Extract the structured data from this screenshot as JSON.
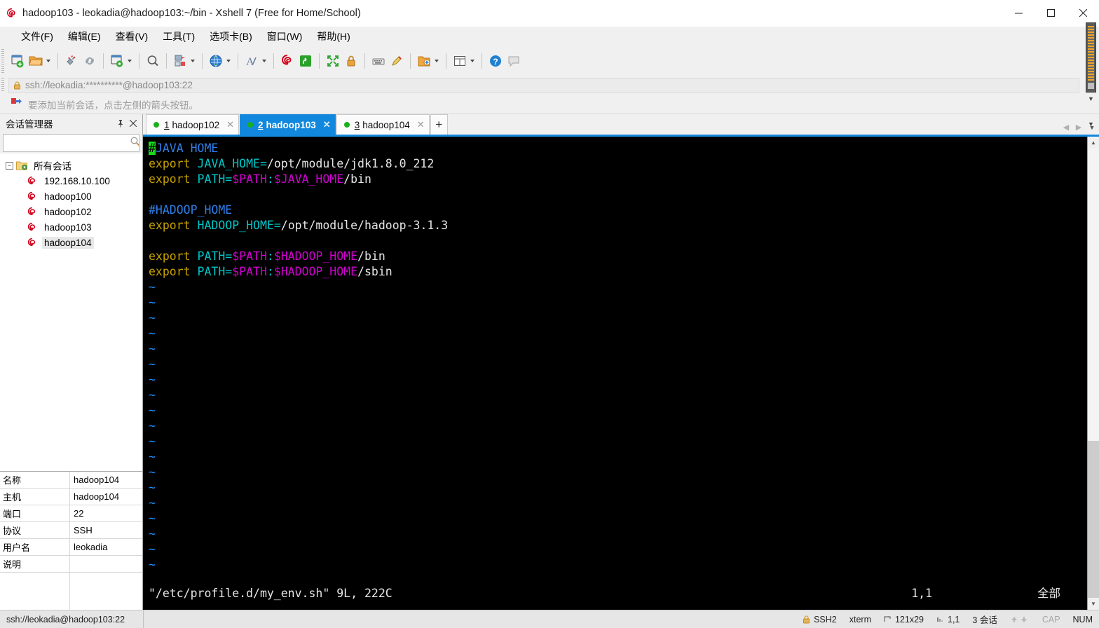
{
  "window": {
    "title": "hadoop103 - leokadia@hadoop103:~/bin - Xshell 7 (Free for Home/School)",
    "app_icon": "xshell-logo-icon",
    "minimize_label": "—",
    "maximize_label": "□",
    "close_label": "✕"
  },
  "menu": {
    "items": [
      {
        "label": "文件(F)",
        "name": "menu-file"
      },
      {
        "label": "编辑(E)",
        "name": "menu-edit"
      },
      {
        "label": "查看(V)",
        "name": "menu-view"
      },
      {
        "label": "工具(T)",
        "name": "menu-tools"
      },
      {
        "label": "选项卡(B)",
        "name": "menu-tabs"
      },
      {
        "label": "窗口(W)",
        "name": "menu-window"
      },
      {
        "label": "帮助(H)",
        "name": "menu-help"
      }
    ]
  },
  "toolbar": {
    "buttons": [
      "new-session-icon",
      "open-folder-icon",
      "disconnect-icon",
      "reconnect-icon",
      "session-properties-icon",
      "find-icon",
      "transfer-file-icon",
      "globe-icon",
      "font-icon",
      "xshell-icon",
      "xftp-icon",
      "fullscreen-icon",
      "lock-icon",
      "keyboard-icon",
      "highlight-icon",
      "new-folder-icon",
      "layout-icon",
      "help-icon",
      "comment-icon"
    ]
  },
  "address": {
    "value": "ssh://leokadia:**********@hadoop103:22",
    "lock_icon": "lock-icon",
    "overflow_label": "»"
  },
  "notify": {
    "icon": "flag-arrow-icon",
    "text": "要添加当前会话，点击左侧的箭头按钮。"
  },
  "sidebar": {
    "title": "会话管理器",
    "pin_label": "⚐",
    "close_label": "✕",
    "search": {
      "value": "",
      "placeholder": ""
    },
    "search_icon": "search-icon",
    "root": {
      "label": "所有会话",
      "icon": "folder-sessions-icon",
      "expander": "−"
    },
    "sessions": [
      {
        "label": "192.168.10.100",
        "icon": "session-icon",
        "selected": false
      },
      {
        "label": "hadoop100",
        "icon": "session-icon",
        "selected": false
      },
      {
        "label": "hadoop102",
        "icon": "session-icon",
        "selected": false
      },
      {
        "label": "hadoop103",
        "icon": "session-icon",
        "selected": false
      },
      {
        "label": "hadoop104",
        "icon": "session-icon",
        "selected": true
      }
    ],
    "properties": [
      {
        "key": "名称",
        "value": "hadoop104"
      },
      {
        "key": "主机",
        "value": "hadoop104"
      },
      {
        "key": "端口",
        "value": "22"
      },
      {
        "key": "协议",
        "value": "SSH"
      },
      {
        "key": "用户名",
        "value": "leokadia"
      },
      {
        "key": "说明",
        "value": ""
      }
    ]
  },
  "tabs": {
    "items": [
      {
        "num": "1",
        "label": "hadoop102",
        "active": false,
        "close": "✕"
      },
      {
        "num": "2",
        "label": "hadoop103",
        "active": true,
        "close": "✕"
      },
      {
        "num": "3",
        "label": "hadoop104",
        "active": false,
        "close": "✕"
      }
    ],
    "add_label": "+",
    "nav_prev": "◀",
    "nav_next": "▶",
    "nav_list": "▼"
  },
  "terminal": {
    "lines": [
      {
        "segments": [
          {
            "t": "#",
            "c": "cursor"
          },
          {
            "t": "JAVA HOME",
            "c": "c-blue"
          }
        ]
      },
      {
        "segments": [
          {
            "t": "export ",
            "c": "c-yellow"
          },
          {
            "t": "JAVA_HOME=",
            "c": "c-cyan"
          },
          {
            "t": "/opt/module/jdk1.8.0_212",
            "c": "c-white"
          }
        ]
      },
      {
        "segments": [
          {
            "t": "export ",
            "c": "c-yellow"
          },
          {
            "t": "PATH=",
            "c": "c-cyan"
          },
          {
            "t": "$PATH",
            "c": "c-mag"
          },
          {
            "t": ":",
            "c": "c-cyan"
          },
          {
            "t": "$JAVA_HOME",
            "c": "c-mag"
          },
          {
            "t": "/bin",
            "c": "c-white"
          }
        ]
      },
      {
        "segments": []
      },
      {
        "segments": [
          {
            "t": "#HADOOP_HOME",
            "c": "c-blue"
          }
        ]
      },
      {
        "segments": [
          {
            "t": "export ",
            "c": "c-yellow"
          },
          {
            "t": "HADOOP_HOME=",
            "c": "c-cyan"
          },
          {
            "t": "/opt/module/hadoop-3.1.3",
            "c": "c-white"
          }
        ]
      },
      {
        "segments": []
      },
      {
        "segments": [
          {
            "t": "export ",
            "c": "c-yellow"
          },
          {
            "t": "PATH=",
            "c": "c-cyan"
          },
          {
            "t": "$PATH",
            "c": "c-mag"
          },
          {
            "t": ":",
            "c": "c-cyan"
          },
          {
            "t": "$HADOOP_HOME",
            "c": "c-mag"
          },
          {
            "t": "/bin",
            "c": "c-white"
          }
        ]
      },
      {
        "segments": [
          {
            "t": "export ",
            "c": "c-yellow"
          },
          {
            "t": "PATH=",
            "c": "c-cyan"
          },
          {
            "t": "$PATH",
            "c": "c-mag"
          },
          {
            "t": ":",
            "c": "c-cyan"
          },
          {
            "t": "$HADOOP_HOME",
            "c": "c-mag"
          },
          {
            "t": "/sbin",
            "c": "c-white"
          }
        ]
      },
      {
        "segments": [
          {
            "t": "~",
            "c": "c-blue2"
          }
        ]
      },
      {
        "segments": [
          {
            "t": "~",
            "c": "c-blue2"
          }
        ]
      },
      {
        "segments": [
          {
            "t": "~",
            "c": "c-blue2"
          }
        ]
      },
      {
        "segments": [
          {
            "t": "~",
            "c": "c-blue2"
          }
        ]
      },
      {
        "segments": [
          {
            "t": "~",
            "c": "c-blue2"
          }
        ]
      },
      {
        "segments": [
          {
            "t": "~",
            "c": "c-blue2"
          }
        ]
      },
      {
        "segments": [
          {
            "t": "~",
            "c": "c-blue2"
          }
        ]
      },
      {
        "segments": [
          {
            "t": "~",
            "c": "c-blue2"
          }
        ]
      },
      {
        "segments": [
          {
            "t": "~",
            "c": "c-blue2"
          }
        ]
      },
      {
        "segments": [
          {
            "t": "~",
            "c": "c-blue2"
          }
        ]
      },
      {
        "segments": [
          {
            "t": "~",
            "c": "c-blue2"
          }
        ]
      },
      {
        "segments": [
          {
            "t": "~",
            "c": "c-blue2"
          }
        ]
      },
      {
        "segments": [
          {
            "t": "~",
            "c": "c-blue2"
          }
        ]
      },
      {
        "segments": [
          {
            "t": "~",
            "c": "c-blue2"
          }
        ]
      },
      {
        "segments": [
          {
            "t": "~",
            "c": "c-blue2"
          }
        ]
      },
      {
        "segments": [
          {
            "t": "~",
            "c": "c-blue2"
          }
        ]
      },
      {
        "segments": [
          {
            "t": "~",
            "c": "c-blue2"
          }
        ]
      },
      {
        "segments": [
          {
            "t": "~",
            "c": "c-blue2"
          }
        ]
      },
      {
        "segments": [
          {
            "t": "~",
            "c": "c-blue2"
          }
        ]
      }
    ],
    "statusline": {
      "file": "\"/etc/profile.d/my_env.sh\" 9L, 222C",
      "position": "1,1",
      "scope": "全部"
    }
  },
  "statusbar": {
    "connection": "ssh://leokadia@hadoop103:22",
    "protocol": "SSH2",
    "term_type": "xterm",
    "size": "121x29",
    "cursor": "1,1",
    "sessions": "3 会话",
    "cap": "CAP",
    "num": "NUM",
    "lock_icon": "lock-icon",
    "size_icon": "resize-icon",
    "cursor_icon": "cursor-icon",
    "up_arrow": "⬆",
    "down_arrow": "⬇"
  }
}
